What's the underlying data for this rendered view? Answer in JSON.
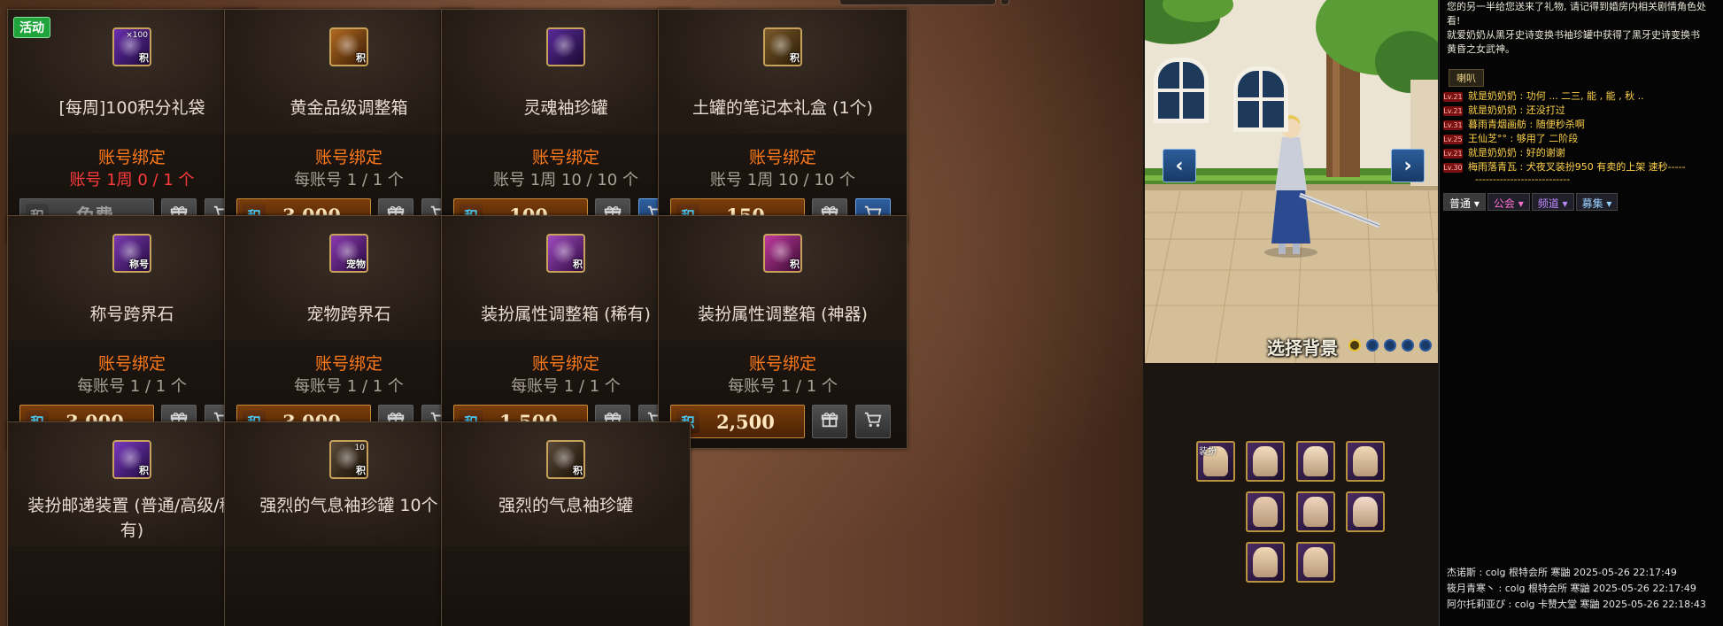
{
  "shop": {
    "cards": [
      {
        "badge": "活动",
        "icon": "points-bag-icon",
        "icon_tag": "积",
        "icon_tag2": "×100",
        "name": "[每周]100积分礼袋",
        "bind": "账号绑定",
        "limit": "账号 1周 0 / 1 个",
        "limit_red": true,
        "price": "免费",
        "free": true,
        "cart_active": false
      },
      {
        "badge": "",
        "icon": "gold-grade-box-icon",
        "icon_tag": "积",
        "icon_tag2": "",
        "name": "黄金品级调整箱",
        "bind": "账号绑定",
        "limit": "每账号 1 / 1 个",
        "limit_red": false,
        "price": "3,000",
        "free": false,
        "cart_active": false
      },
      {
        "badge": "",
        "icon": "soul-jar-icon",
        "icon_tag": "",
        "icon_tag2": "",
        "name": "灵魂袖珍罐",
        "bind": "账号绑定",
        "limit": "账号 1周 10 / 10 个",
        "limit_red": false,
        "price": "100",
        "free": false,
        "cart_active": true
      },
      {
        "badge": "",
        "icon": "notebook-box-icon",
        "icon_tag": "积",
        "icon_tag2": "",
        "name": "土罐的笔记本礼盒 (1个)",
        "bind": "账号绑定",
        "limit": "账号 1周 10 / 10 个",
        "limit_red": false,
        "price": "150",
        "free": false,
        "cart_active": true
      },
      {
        "badge": "",
        "icon": "title-stone-icon",
        "icon_tag": "称号",
        "icon_tag2": "",
        "name": "称号跨界石",
        "bind": "账号绑定",
        "limit": "每账号 1 / 1 个",
        "limit_red": false,
        "price": "3,000",
        "free": false,
        "cart_active": false
      },
      {
        "badge": "",
        "icon": "pet-stone-icon",
        "icon_tag": "宠物",
        "icon_tag2": "",
        "name": "宠物跨界石",
        "bind": "账号绑定",
        "limit": "每账号 1 / 1 个",
        "limit_red": false,
        "price": "3,000",
        "free": false,
        "cart_active": false
      },
      {
        "badge": "",
        "icon": "avatar-box-rare-icon",
        "icon_tag": "积",
        "icon_tag2": "",
        "name": "装扮属性调整箱 (稀有)",
        "bind": "账号绑定",
        "limit": "每账号 1 / 1 个",
        "limit_red": false,
        "price": "1,500",
        "free": false,
        "cart_active": false
      },
      {
        "badge": "",
        "icon": "avatar-box-artifact-icon",
        "icon_tag": "积",
        "icon_tag2": "",
        "name": "装扮属性调整箱 (神器)",
        "bind": "账号绑定",
        "limit": "每账号 1 / 1 个",
        "limit_red": false,
        "price": "2,500",
        "free": false,
        "cart_active": false
      },
      {
        "badge": "",
        "icon": "avatar-mail-device-icon",
        "icon_tag": "积",
        "icon_tag2": "",
        "name": "装扮邮递装置 (普通/高级/稀有)",
        "bind": "",
        "limit": "",
        "limit_red": false,
        "price": "",
        "free": false,
        "cart_active": false
      },
      {
        "badge": "",
        "icon": "strong-aura-jar-10-icon",
        "icon_tag": "积",
        "icon_tag2": "10",
        "name": "强烈的气息袖珍罐 10个",
        "bind": "",
        "limit": "",
        "limit_red": false,
        "price": "",
        "free": false,
        "cart_active": false
      },
      {
        "badge": "",
        "icon": "strong-aura-jar-icon",
        "icon_tag": "积",
        "icon_tag2": "",
        "name": "强烈的气息袖珍罐",
        "bind": "",
        "limit": "",
        "limit_red": false,
        "price": "",
        "free": false,
        "cart_active": false
      }
    ]
  },
  "preview": {
    "prev_label": "‹",
    "next_label": "›",
    "background_select": "选择背景",
    "dots": [
      true,
      false,
      false,
      false,
      false
    ],
    "avatar_slots": [
      "hair-slot-icon",
      "face-slot-icon",
      "top-slot-icon",
      "cap-slot-icon",
      "belt-slot-icon",
      "coat-slot-icon",
      "pants-slot-icon",
      "shoes-slot-icon",
      "skin-slot-icon"
    ],
    "avatar_slot_labels": [
      "装扮",
      "",
      "",
      "",
      "",
      "",
      "",
      "",
      ""
    ]
  },
  "chat": {
    "system_lines": [
      "您的另一半给您送来了礼物, 请记得到婚房内相关剧情角色处",
      "看!",
      "就爱奶奶从黑牙史诗变换书袖珍罐中获得了黑牙史诗变换书",
      "黄昏之女武神。"
    ],
    "tab_label": "喇叭",
    "messages": [
      {
        "lv": "Lv.21",
        "text": "就是奶奶奶 : 功何 ... 二三, 能 , 能 , 秋 ..",
        "color": "#ffd34a"
      },
      {
        "lv": "Lv.21",
        "text": "就是奶奶奶 : 还没打过",
        "color": "#ffd34a"
      },
      {
        "lv": "Lv.31",
        "text": "暮雨青烟画舫 : 随便秒杀啊",
        "color": "#ffd34a"
      },
      {
        "lv": "Lv.25",
        "text": "王仙芝°° : 够用了 二阶段",
        "color": "#ffd34a"
      },
      {
        "lv": "Lv.21",
        "text": "就是奶奶奶 : 好的谢谢",
        "color": "#ffd34a"
      },
      {
        "lv": "Lv.30",
        "text": "梅雨落青瓦 : 犬夜叉装扮950   有卖的上架 速秒-----",
        "color": "#ffd34a"
      },
      {
        "lv": "",
        "text": "---------------------------",
        "color": "#ffd34a"
      }
    ],
    "channels": [
      "普通",
      "公会",
      "频道",
      "募集"
    ],
    "footer_lines": [
      "杰诺斯 : colg  根特会所  寒鼬  2025-05-26  22:17:49",
      "筱月青寒丶 : colg  根特会所  寒鼬  2025-05-26  22:17:49",
      "阿尔托莉亚ぴ : colg  卡赞大堂  寒鼬  2025-05-26  22:18:43"
    ]
  }
}
